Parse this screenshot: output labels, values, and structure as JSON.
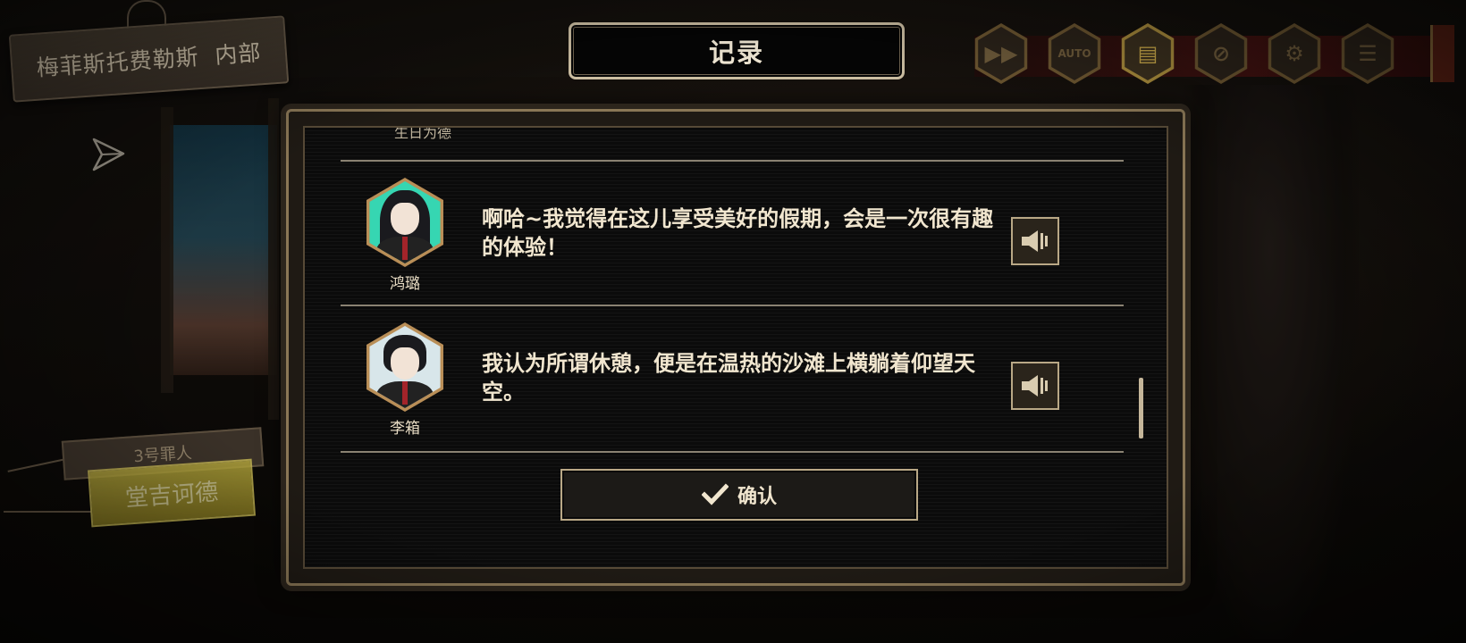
{
  "location": {
    "name": "梅菲斯托费勒斯  内部"
  },
  "log": {
    "title": "记录",
    "cut_speaker": "生日为德",
    "entries": [
      {
        "speaker": "鸿璐",
        "text": "啊哈~我觉得在这儿享受美好的假期，会是一次很有趣的体验！",
        "avatar": "teal-long-hair-portrait"
      },
      {
        "speaker": "李箱",
        "text": "我认为所谓休憩，便是在温热的沙滩上横躺着仰望天空。",
        "avatar": "dark-hair-portrait"
      }
    ],
    "confirm_label": "确认"
  },
  "character_tags": {
    "small": "3号罪人",
    "large": "堂吉诃德"
  },
  "toolbar": [
    {
      "name": "fast-forward",
      "icon": "fast-forward-icon",
      "glyph": "▶▶",
      "active": false
    },
    {
      "name": "auto",
      "icon": "auto-icon",
      "glyph": "AUTO",
      "active": false
    },
    {
      "name": "log",
      "icon": "log-icon",
      "glyph": "▤",
      "active": true
    },
    {
      "name": "hide-ui",
      "icon": "hide-ui-icon",
      "glyph": "⊘",
      "active": false
    },
    {
      "name": "settings",
      "icon": "gear-icon",
      "glyph": "⚙",
      "active": false
    },
    {
      "name": "menu",
      "icon": "menu-icon",
      "glyph": "☰",
      "active": false
    }
  ],
  "colors": {
    "accent": "#c7a648",
    "frame": "#8a7756",
    "text": "#f1e6cf",
    "tag": "#b7a93c"
  }
}
